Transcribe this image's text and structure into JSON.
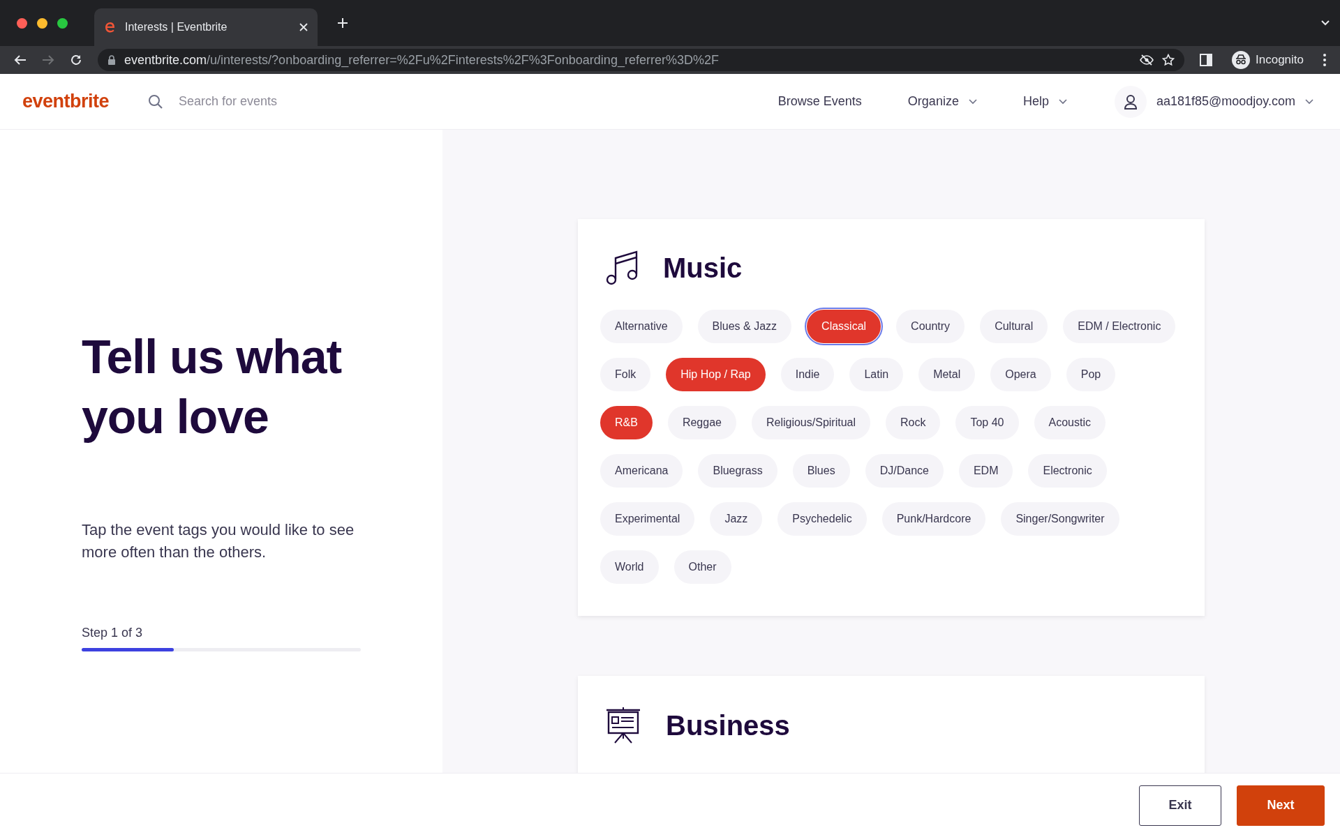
{
  "browser": {
    "tab_title": "Interests | Eventbrite",
    "url_host": "eventbrite.com",
    "url_path": "/u/interests/?onboarding_referrer=%2Fu%2Finterests%2F%3Fonboarding_referrer%3D%2F",
    "profile": "Incognito"
  },
  "header": {
    "logo": "eventbrite",
    "search": {
      "placeholder": "Search for events"
    },
    "nav": [
      {
        "label": "Browse Events",
        "dropdown": false
      },
      {
        "label": "Organize",
        "dropdown": true
      },
      {
        "label": "Help",
        "dropdown": true
      }
    ],
    "account": "aa181f85@moodjoy.com"
  },
  "intro": {
    "heading": "Tell us what you love",
    "description": "Tap the event tags you would like to see more often than the others.",
    "step": "Step 1 of 3",
    "progress": {
      "level": 0.33
    }
  },
  "categories": [
    {
      "title": "Music",
      "kind": "music",
      "tag_rows": [
        [
          {
            "label": "Alternative",
            "selected": false,
            "focused": false
          },
          {
            "label": "Blues & Jazz",
            "selected": false,
            "focused": false
          },
          {
            "label": "Classical",
            "selected": true,
            "focused": true
          },
          {
            "label": "Country",
            "selected": false,
            "focused": false
          },
          {
            "label": "Cultural",
            "selected": false,
            "focused": false
          },
          {
            "label": "EDM / Electronic",
            "selected": false,
            "focused": false
          }
        ],
        [
          {
            "label": "Folk",
            "selected": false,
            "focused": false
          },
          {
            "label": "Hip Hop / Rap",
            "selected": true,
            "focused": false
          },
          {
            "label": "Indie",
            "selected": false,
            "focused": false
          },
          {
            "label": "Latin",
            "selected": false,
            "focused": false
          },
          {
            "label": "Metal",
            "selected": false,
            "focused": false
          },
          {
            "label": "Opera",
            "selected": false,
            "focused": false
          },
          {
            "label": "Pop",
            "selected": false,
            "focused": false
          }
        ],
        [
          {
            "label": "R&B",
            "selected": true,
            "focused": false
          },
          {
            "label": "Reggae",
            "selected": false,
            "focused": false
          },
          {
            "label": "Religious/Spiritual",
            "selected": false,
            "focused": false
          },
          {
            "label": "Rock",
            "selected": false,
            "focused": false
          },
          {
            "label": "Top 40",
            "selected": false,
            "focused": false
          },
          {
            "label": "Acoustic",
            "selected": false,
            "focused": false
          }
        ],
        [
          {
            "label": "Americana",
            "selected": false,
            "focused": false
          },
          {
            "label": "Bluegrass",
            "selected": false,
            "focused": false
          },
          {
            "label": "Blues",
            "selected": false,
            "focused": false
          },
          {
            "label": "DJ/Dance",
            "selected": false,
            "focused": false
          },
          {
            "label": "EDM",
            "selected": false,
            "focused": false
          },
          {
            "label": "Electronic",
            "selected": false,
            "focused": false
          }
        ],
        [
          {
            "label": "Experimental",
            "selected": false,
            "focused": false
          },
          {
            "label": "Jazz",
            "selected": false,
            "focused": false
          },
          {
            "label": "Psychedelic",
            "selected": false,
            "focused": false
          },
          {
            "label": "Punk/Hardcore",
            "selected": false,
            "focused": false
          },
          {
            "label": "Singer/Songwriter",
            "selected": false,
            "focused": false
          }
        ],
        [
          {
            "label": "World",
            "selected": false,
            "focused": false
          },
          {
            "label": "Other",
            "selected": false,
            "focused": false
          }
        ]
      ]
    },
    {
      "title": "Business",
      "kind": "business"
    }
  ],
  "footer": {
    "buttons": [
      {
        "label": "Exit",
        "kind": "outline"
      },
      {
        "label": "Next",
        "kind": "primary"
      }
    ]
  }
}
